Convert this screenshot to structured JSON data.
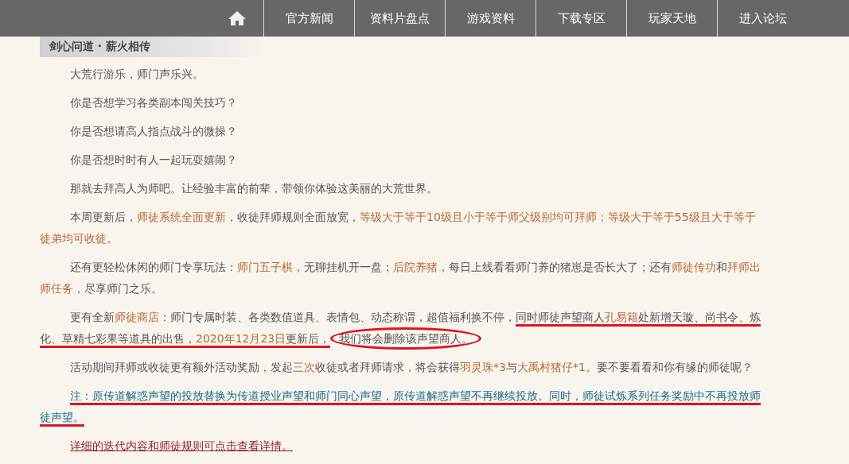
{
  "nav": {
    "items": [
      {
        "label": "官方新闻"
      },
      {
        "label": "资料片盘点"
      },
      {
        "label": "游戏资料"
      },
      {
        "label": "下载专区"
      },
      {
        "label": "玩家天地"
      },
      {
        "label": "进入论坛"
      }
    ]
  },
  "article": {
    "title": "剑心问道 · 薪火相传",
    "paragraphs": [
      {
        "kind": "text",
        "segments": [
          {
            "text": "大荒行游乐，师门声乐兴。",
            "kind": "plain"
          }
        ]
      },
      {
        "kind": "text",
        "segments": [
          {
            "text": "你是否想学习各类副本闯关技巧？",
            "kind": "plain"
          }
        ]
      },
      {
        "kind": "text",
        "segments": [
          {
            "text": "你是否想请高人指点战斗的微操？",
            "kind": "plain"
          }
        ]
      },
      {
        "kind": "text",
        "segments": [
          {
            "text": "你是否想时时有人一起玩耍嬉闹？",
            "kind": "plain"
          }
        ]
      },
      {
        "kind": "text",
        "segments": [
          {
            "text": "那就去拜高人为师吧。让经验丰富的前辈，带领你体验这美丽的大荒世界。",
            "kind": "plain"
          }
        ]
      },
      {
        "kind": "text",
        "segments": [
          {
            "text": "本周更新后，",
            "kind": "plain"
          },
          {
            "text": "师徒系统全面更新",
            "kind": "highlight"
          },
          {
            "text": "，收徒拜师规则全面放宽，",
            "kind": "plain"
          },
          {
            "text": "等级大于等于10级且小于等于师父级别均可拜师；等级大于等于55级且大于等于徒弟均可收徒",
            "kind": "highlight"
          },
          {
            "text": "。",
            "kind": "plain"
          }
        ]
      },
      {
        "kind": "text",
        "segments": [
          {
            "text": "还有更轻松休闲的师门专享玩法：",
            "kind": "plain"
          },
          {
            "text": "师门五子棋",
            "kind": "highlight"
          },
          {
            "text": "，无聊挂机开一盘；",
            "kind": "plain"
          },
          {
            "text": "后院养猪",
            "kind": "highlight"
          },
          {
            "text": "，每日上线看看师门养的猪崽是否长大了；还有",
            "kind": "plain"
          },
          {
            "text": "师徒传功",
            "kind": "highlight"
          },
          {
            "text": "和",
            "kind": "plain"
          },
          {
            "text": "拜师出师任务",
            "kind": "highlight"
          },
          {
            "text": "，尽享师门之乐。",
            "kind": "plain"
          }
        ]
      },
      {
        "kind": "text",
        "segments": [
          {
            "text": "更有全新",
            "kind": "plain",
            "underlined": false,
            "circled": false
          },
          {
            "text": "师徒商店",
            "kind": "highlight",
            "underlined": false,
            "circled": false
          },
          {
            "text": "：师门专属时装、各类数值道具、表情包、动态称谓，超值福利换不停，",
            "kind": "plain",
            "underlined": false,
            "circled": false
          },
          {
            "text": "同时师徒声望商人",
            "kind": "plain",
            "underlined": true,
            "circled": false
          },
          {
            "text": "孔易籍",
            "kind": "highlight",
            "underlined": true,
            "circled": false
          },
          {
            "text": "处新增天璇、尚书令、炼化、草精七彩果等道具的出售，",
            "kind": "plain",
            "underlined": true,
            "circled": false
          },
          {
            "text": "2020年12月23日",
            "kind": "highlight",
            "underlined": true,
            "circled": false
          },
          {
            "text": "更新后，",
            "kind": "plain",
            "underlined": true,
            "circled": false
          },
          {
            "text": "我们将会删除该声望商人。",
            "kind": "plain",
            "underlined": false,
            "circled": true
          }
        ]
      },
      {
        "kind": "text",
        "segments": [
          {
            "text": "活动期间拜师或收徒更有额外活动奖励，发起",
            "kind": "plain"
          },
          {
            "text": "三次",
            "kind": "highlight"
          },
          {
            "text": "收徒或者拜师请求，将会获得",
            "kind": "plain"
          },
          {
            "text": "羽灵珠*3",
            "kind": "highlight"
          },
          {
            "text": "与",
            "kind": "plain"
          },
          {
            "text": "大禹村猪仔*1",
            "kind": "highlight"
          },
          {
            "text": "。要不要看看和你有缘的师徒呢？",
            "kind": "plain"
          }
        ]
      },
      {
        "kind": "note",
        "segments": [
          {
            "text": "注：原传道解惑声望的投放替换为传道授业声望和师门同心声望，原传道解惑声望不再继续投放。同时，师徒试炼系列任务奖励中不再投放师徒声望。",
            "kind": "note",
            "underlined": true
          }
        ]
      },
      {
        "kind": "link",
        "segments": [
          {
            "text": "详细的迭代内容和师徒规则可点击查看详情。",
            "kind": "link"
          }
        ]
      }
    ]
  }
}
